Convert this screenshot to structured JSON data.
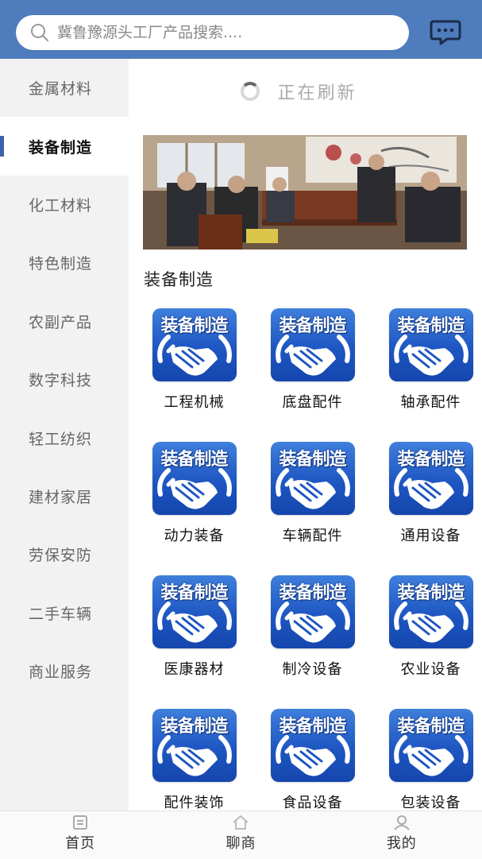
{
  "search": {
    "placeholder": "冀鲁豫源头工厂产品搜索...."
  },
  "header": {
    "message_icon": "chat-bubble-icon"
  },
  "sidebar": {
    "items": [
      {
        "label": "金属材料",
        "active": false
      },
      {
        "label": "装备制造",
        "active": true
      },
      {
        "label": "化工材料",
        "active": false
      },
      {
        "label": "特色制造",
        "active": false
      },
      {
        "label": "农副产品",
        "active": false
      },
      {
        "label": "数字科技",
        "active": false
      },
      {
        "label": "轻工纺织",
        "active": false
      },
      {
        "label": "建材家居",
        "active": false
      },
      {
        "label": "劳保安防",
        "active": false
      },
      {
        "label": "二手车辆",
        "active": false
      },
      {
        "label": "商业服务",
        "active": false
      }
    ]
  },
  "refresh": {
    "text": "正在刷新"
  },
  "main": {
    "section_title": "装备制造",
    "tile_text": "装备制造",
    "categories": [
      {
        "label": "工程机械"
      },
      {
        "label": "底盘配件"
      },
      {
        "label": "轴承配件"
      },
      {
        "label": "动力装备"
      },
      {
        "label": "车辆配件"
      },
      {
        "label": "通用设备"
      },
      {
        "label": "医康器材"
      },
      {
        "label": "制冷设备"
      },
      {
        "label": "农业设备"
      },
      {
        "label": "配件装饰"
      },
      {
        "label": "食品设备"
      },
      {
        "label": "包装设备"
      }
    ]
  },
  "bottom_nav": {
    "items": [
      {
        "label": "首页",
        "icon": "home-page-icon"
      },
      {
        "label": "聊商",
        "icon": "house-icon"
      },
      {
        "label": "我的",
        "icon": "user-icon"
      }
    ]
  },
  "colors": {
    "header": "#4f7cbc",
    "accent": "#3a62a8",
    "tile": "#1e56c2"
  }
}
